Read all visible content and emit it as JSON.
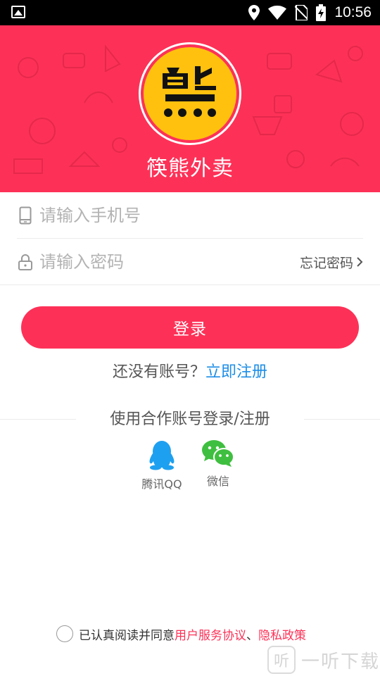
{
  "status_bar": {
    "time": "10:56"
  },
  "header": {
    "app_name": "筷熊外卖",
    "logo_char": "熊"
  },
  "form": {
    "phone_placeholder": "请输入手机号",
    "password_placeholder": "请输入密码",
    "forgot_label": "忘记密码"
  },
  "login_button": "登录",
  "register": {
    "prompt": "还没有账号？",
    "link": "立即注册"
  },
  "third_party": {
    "title": "使用合作账号登录/注册",
    "options": [
      {
        "label": "腾讯QQ",
        "icon": "qq-penguin-icon"
      },
      {
        "label": "微信",
        "icon": "wechat-icon"
      }
    ]
  },
  "agreement": {
    "prefix": "已认真阅读并同意",
    "terms": "用户服务协议",
    "separator": "、",
    "privacy": "隐私政策",
    "checked": false
  },
  "watermark": {
    "mark": "听",
    "text": "一听下载"
  },
  "colors": {
    "brand_red": "#fd3157",
    "link_blue": "#1d8ee6",
    "logo_yellow": "#ffc10e",
    "qq_blue": "#1ea0f0",
    "wechat_green": "#3fbf3f"
  }
}
